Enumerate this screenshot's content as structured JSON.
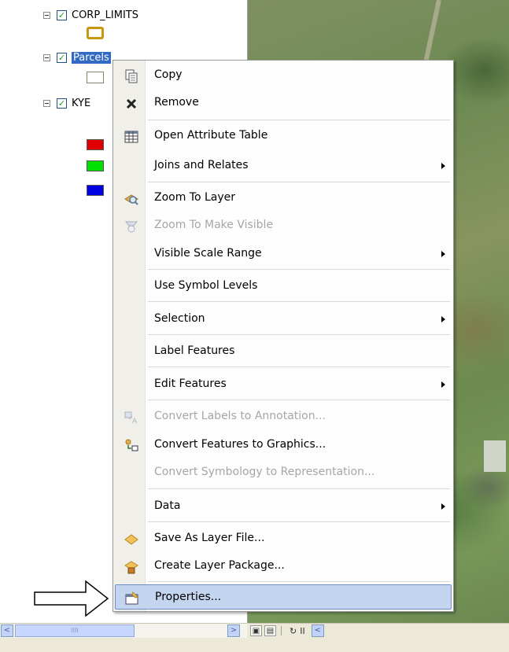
{
  "toc": {
    "layers": [
      {
        "name": "CORP_LIMITS",
        "checked": true,
        "symbol_color": "#c8960f"
      },
      {
        "name": "Parcels",
        "checked": true,
        "selected": true,
        "symbol_color": "#7b8a63"
      },
      {
        "name": "KYE",
        "checked": true
      }
    ],
    "legend_colors": [
      "#e00000",
      "#00e000",
      "#0000e0"
    ]
  },
  "context_menu": {
    "items": [
      {
        "label": "Copy",
        "icon": "copy-icon",
        "enabled": true,
        "submenu": false
      },
      {
        "label": "Remove",
        "icon": "remove-x-icon",
        "enabled": true,
        "submenu": false
      },
      {
        "label": "Open Attribute Table",
        "icon": "attribute-table-icon",
        "enabled": true,
        "submenu": false
      },
      {
        "label": "Joins and Relates",
        "icon": "",
        "enabled": true,
        "submenu": true
      },
      {
        "label": "Zoom To Layer",
        "icon": "zoom-to-layer-icon",
        "enabled": true,
        "submenu": false
      },
      {
        "label": "Zoom To Make Visible",
        "icon": "zoom-visible-icon",
        "enabled": false,
        "submenu": false
      },
      {
        "label": "Visible Scale Range",
        "icon": "",
        "enabled": true,
        "submenu": true
      },
      {
        "label": "Use Symbol Levels",
        "icon": "",
        "enabled": true,
        "submenu": false
      },
      {
        "label": "Selection",
        "icon": "",
        "enabled": true,
        "submenu": true
      },
      {
        "label": "Label Features",
        "icon": "",
        "enabled": true,
        "submenu": false
      },
      {
        "label": "Edit Features",
        "icon": "",
        "enabled": true,
        "submenu": true
      },
      {
        "label": "Convert Labels to Annotation...",
        "icon": "convert-labels-icon",
        "enabled": false,
        "submenu": false
      },
      {
        "label": "Convert Features to Graphics...",
        "icon": "convert-graphics-icon",
        "enabled": true,
        "submenu": false
      },
      {
        "label": "Convert Symbology to Representation...",
        "icon": "",
        "enabled": false,
        "submenu": false
      },
      {
        "label": "Data",
        "icon": "",
        "enabled": true,
        "submenu": true
      },
      {
        "label": "Save As Layer File...",
        "icon": "layer-file-icon",
        "enabled": true,
        "submenu": false
      },
      {
        "label": "Create Layer Package...",
        "icon": "layer-package-icon",
        "enabled": true,
        "submenu": false
      },
      {
        "label": "Properties...",
        "icon": "properties-icon",
        "enabled": true,
        "submenu": false,
        "highlighted": true
      }
    ]
  },
  "bottom_bar": {
    "scroll_left_glyph": "<",
    "scroll_right_glyph": ">",
    "thumb_grip": "IIII",
    "map_tool_glyphs": {
      "refresh": "↻",
      "pause": "II",
      "back": "<"
    }
  }
}
